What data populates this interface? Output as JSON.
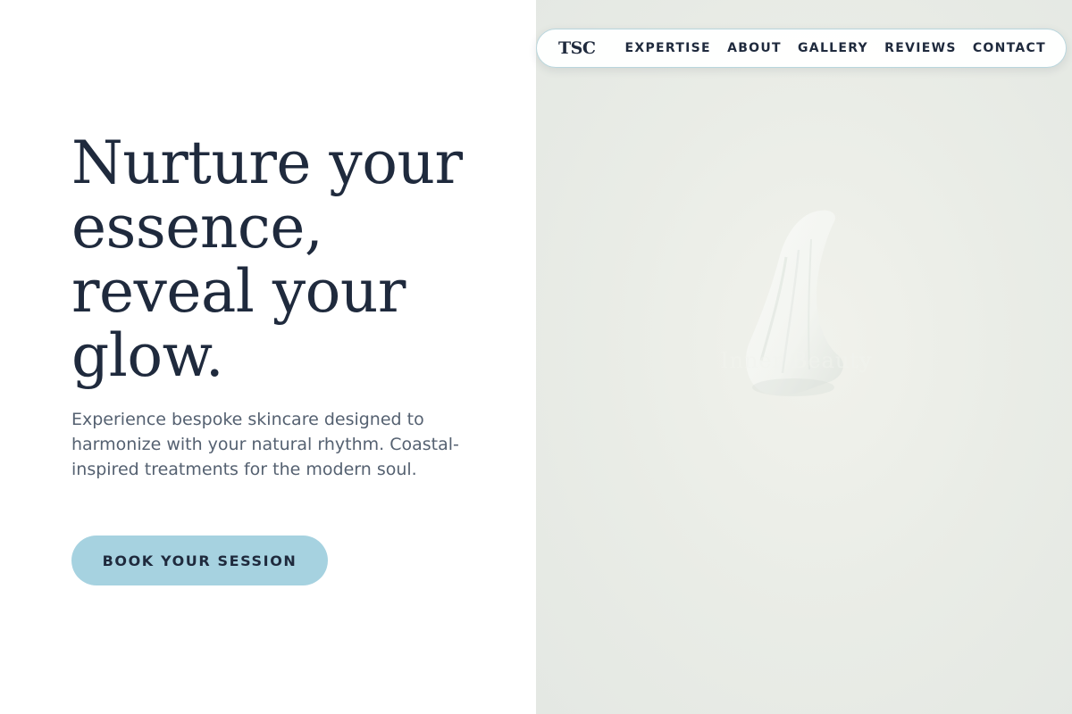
{
  "nav": {
    "logo": "TSC",
    "links": [
      {
        "label": "EXPERTISE"
      },
      {
        "label": "ABOUT"
      },
      {
        "label": "GALLERY"
      },
      {
        "label": "REVIEWS"
      },
      {
        "label": "CONTACT"
      }
    ]
  },
  "hero": {
    "headline": "Nurture your essence, reveal your glow.",
    "description": "Experience bespoke skincare designed to harmonize with your natural rhythm. Coastal-inspired treatments for the modern soul.",
    "cta_label": "BOOK YOUR SESSION"
  },
  "image": {
    "overlay_text": "Inner Beauty"
  },
  "colors": {
    "text_dark": "#1f2a3d",
    "text_muted": "#556171",
    "accent": "#a6d2e0",
    "image_bg": "#e9ece6",
    "nav_border": "#b9d6dd"
  }
}
